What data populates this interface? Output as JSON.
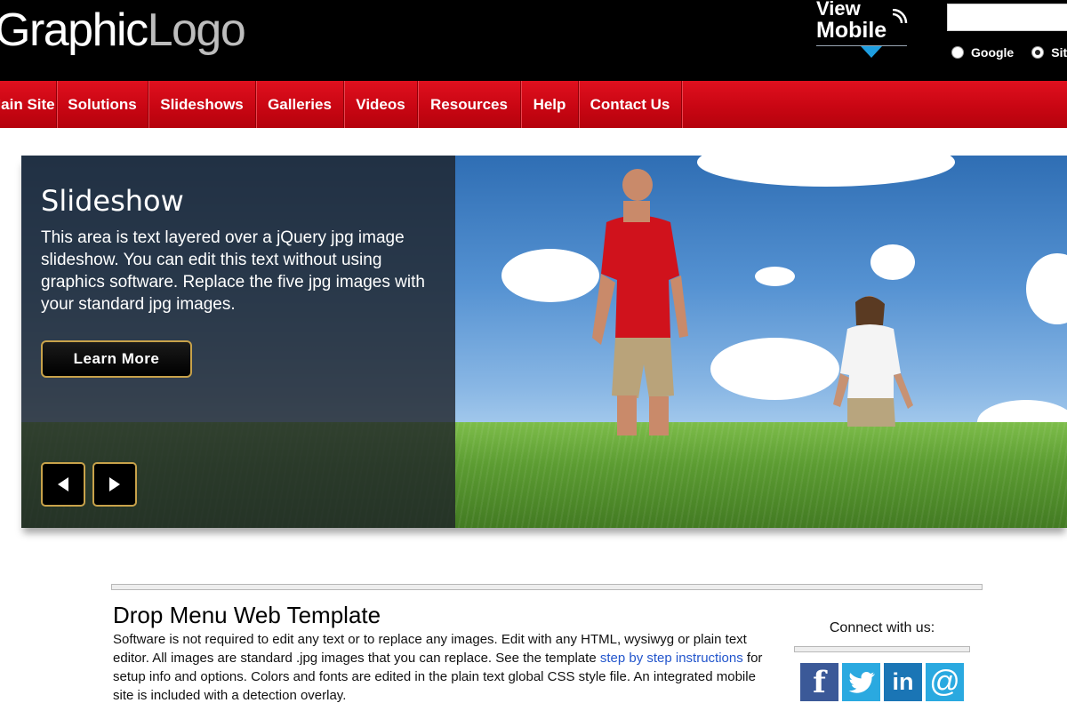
{
  "header": {
    "logo_word1": "Graphic",
    "logo_word2": "Logo",
    "view_mobile": {
      "line1": "View",
      "line2": "Mobile"
    },
    "search": {
      "value": ""
    },
    "radios": [
      {
        "label": "Google",
        "checked": false
      },
      {
        "label": "Site",
        "checked": true
      }
    ]
  },
  "nav": {
    "items": [
      "Main Site",
      "Solutions",
      "Slideshows",
      "Galleries",
      "Videos",
      "Resources",
      "Help",
      "Contact Us"
    ]
  },
  "slideshow": {
    "title": "Slideshow",
    "text": "This area is text layered over a jQuery jpg image slideshow. You can edit this text without using graphics software. Replace the five jpg images with your standard jpg images.",
    "button_label": "Learn More",
    "prev_icon": "play-left-icon",
    "next_icon": "play-right-icon"
  },
  "content": {
    "title": "Drop Menu Web Template",
    "text_before_link": "Software is not required to edit any text or to replace any images. Edit with any HTML, wysiwyg or plain text editor. All images are standard .jpg images that you can replace. See the template ",
    "link_text": "step by step instructions",
    "text_after_link": " for setup info and options. Colors and fonts are edited in the plain text global CSS style file. An integrated mobile site is included with a detection overlay."
  },
  "social": {
    "label": "Connect with us:",
    "icons": [
      {
        "name": "facebook-icon",
        "glyph": "f",
        "color": "#3b5998"
      },
      {
        "name": "twitter-icon",
        "glyph": "",
        "color": "#2aa9e0"
      },
      {
        "name": "linkedin-icon",
        "glyph": "in",
        "color": "#1a75b5"
      },
      {
        "name": "email-icon",
        "glyph": "@",
        "color": "#2aa9e0"
      }
    ]
  },
  "colors": {
    "nav_red": "#c90613",
    "header_black": "#000000",
    "button_border": "#c8a24a",
    "link_blue": "#2255cc"
  }
}
